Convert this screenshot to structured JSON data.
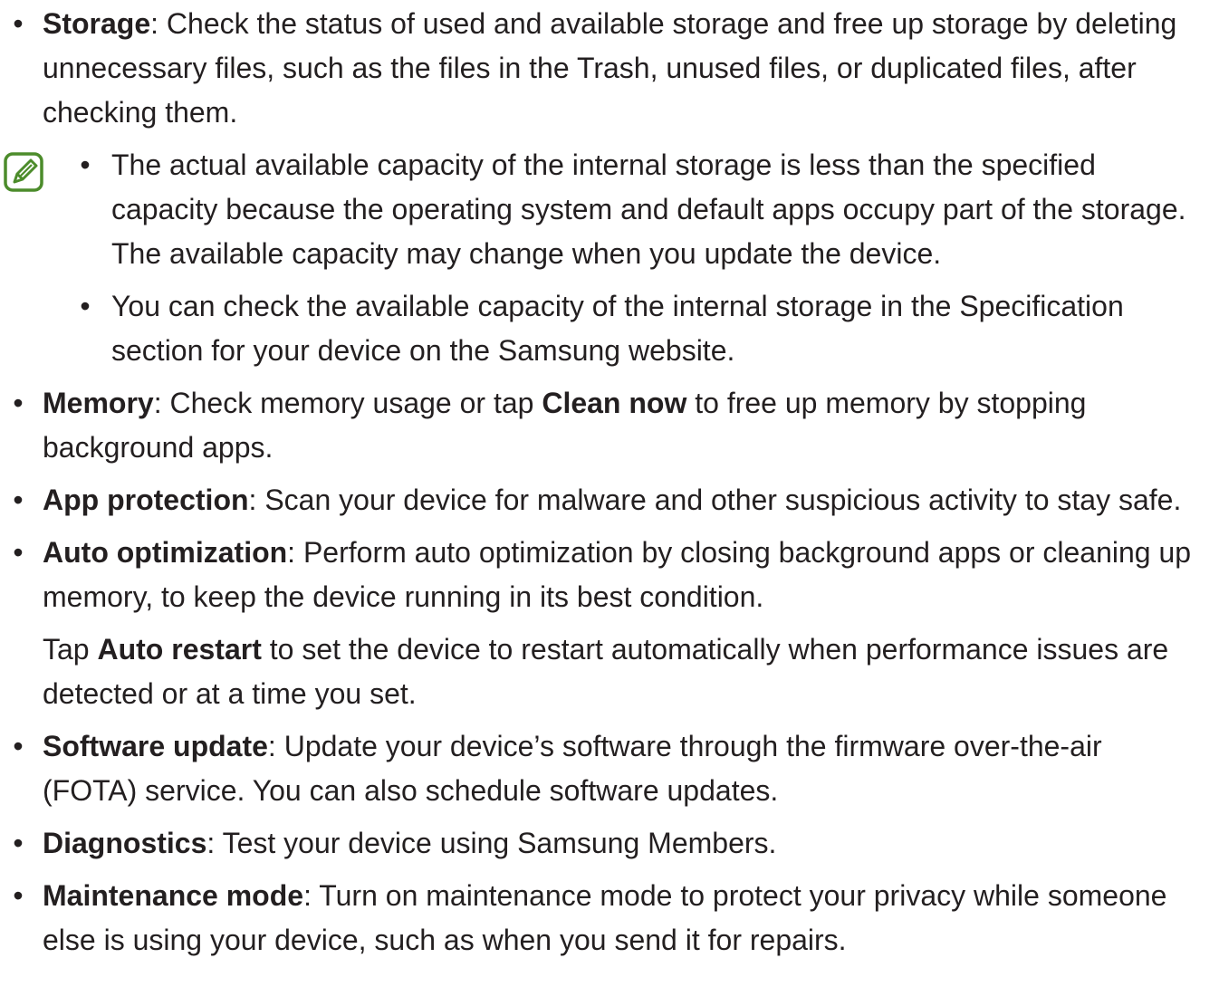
{
  "items": [
    {
      "term": "Storage",
      "text": ": Check the status of used and available storage and free up storage by deleting unnecessary files, such as the files in the Trash, unused files, or duplicated files, after checking them."
    },
    {
      "term": "Memory",
      "text_a": ": Check memory usage or tap ",
      "bold_a": "Clean now",
      "text_b": " to free up memory by stopping background apps."
    },
    {
      "term": "App protection",
      "text": ": Scan your device for malware and other suspicious activity to stay safe."
    },
    {
      "term": "Auto optimization",
      "text": ": Perform auto optimization by closing background apps or cleaning up memory, to keep the device running in its best condition.",
      "extra_a": "Tap ",
      "extra_bold": "Auto restart",
      "extra_b": " to set the device to restart automatically when performance issues are detected or at a time you set."
    },
    {
      "term": "Software update",
      "text": ": Update your device’s software through the firmware over-the-air (FOTA) service. You can also schedule software updates."
    },
    {
      "term": "Diagnostics",
      "text": ": Test your device using Samsung Members."
    },
    {
      "term": "Maintenance mode",
      "text": ": Turn on maintenance mode to protect your privacy while someone else is using your device, such as when you send it for repairs."
    }
  ],
  "note": {
    "icon": "note-pencil-icon",
    "icon_color": "#4c8c2b",
    "items": [
      "The actual available capacity of the internal storage is less than the specified capacity because the operating system and default apps occupy part of the storage. The available capacity may change when you update the device.",
      "You can check the available capacity of the internal storage in the Specification section for your device on the Samsung website."
    ]
  },
  "bullet_char": "•"
}
